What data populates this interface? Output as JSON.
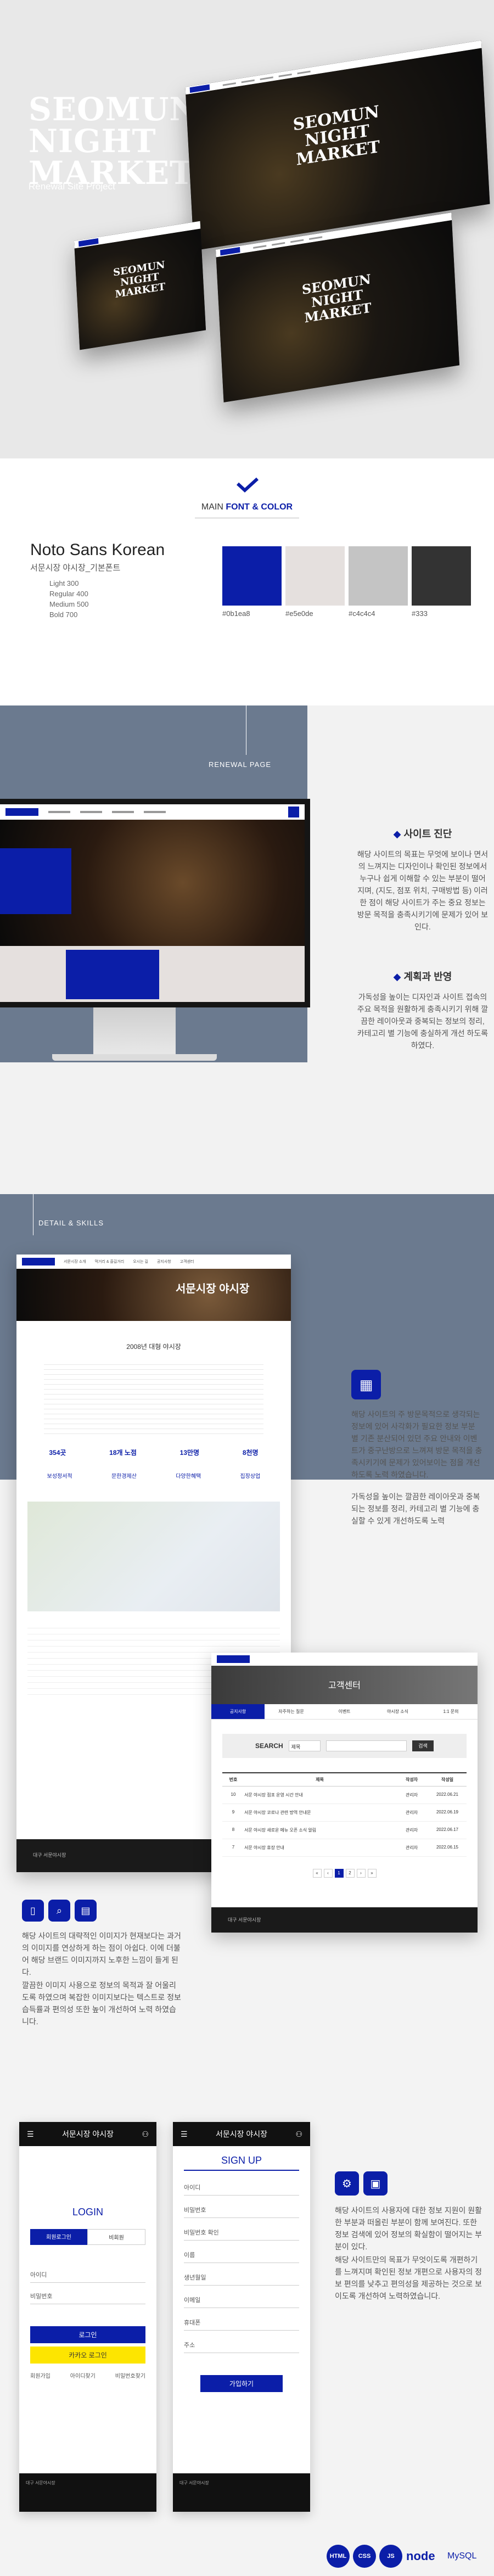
{
  "hero": {
    "title_lines": [
      "SEOMUN",
      "NIGHT",
      "MARKET"
    ],
    "subtitle": "Renewal Site Project",
    "mock_title_lines": [
      "SEOMUN",
      "NIGHT",
      "MARKET"
    ],
    "background_color": "#e8e8e8"
  },
  "font_color": {
    "heading_prefix": "MAIN",
    "heading_bold": "FONT & COLOR",
    "font_name": "Noto Sans Korean",
    "font_caption": "서문시장 야시장_기본폰트",
    "weights": [
      "Light 300",
      "Regular 400",
      "Medium 500",
      "Bold 700"
    ],
    "colors": [
      {
        "hex": "#0b1ea8",
        "label": "#0b1ea8"
      },
      {
        "hex": "#e5e0de",
        "label": "#e5e0de"
      },
      {
        "hex": "#c4c4c4",
        "label": "#c4c4c4"
      },
      {
        "hex": "#333333",
        "label": "#333"
      }
    ]
  },
  "renewal": {
    "label": "RENEWAL PAGE",
    "features": [
      {
        "title": "사이트 진단",
        "text": "해당 사이트의 목표는 무엇에 보이나 면서의 느껴지는 디자인이나 확인된 정보에서 누구나 쉽게 이해할 수 있는 부분이 떨어지며, (지도, 점포 위치, 구매방법 등) 이러한 점이 해당 사이트가 주는 중요 정보는 방문 목적을 충족시키기에 문제가 있어 보인다."
      },
      {
        "title": "계획과 반영",
        "text": "가독성을 높이는 디자인과 사이트 접속의 주요 목적을 원활하게 충족시키기 위해 깔끔한 레이아웃과 중복되는 정보의 정리, 카테고리 별 기능에 충실하게 개선 하도록 하였다."
      }
    ]
  },
  "detail": {
    "label": "DETAIL & SKILLS",
    "right_text_1": "해당 사이트의 주 방문목적으로 생각되는 정보에 있어 사각화가 필요한 정보 부분 별 기존 분산되어 있던 주요 안내와 이벤트가 중구난방으로 느껴져 방문 목적을 충족시키기에 문제가 있어보이는 점을 개선하도록 노력 하였습니다.",
    "right_text_2": "가독성을 높이는 깔끔한 레이아웃과 중복되는 정보를 정리, 카테고리 별 기능에 충실할 수 있게 개선하도록 노력",
    "left_text_1": "해당 사이트의 대략적인 이미지가 현재보다는 과거의 이미지를 연상하게 하는 점이 아쉽다. 이에 더불어 해당 브랜드 이미지까지 노후한 느낌이 들게 된다.",
    "left_text_2": "깔끔한 이미지 사용으로 정보의 목적과 잘 어울리도록 하였으며 복잡한 이미지보다는 텍스트로 정보 습득률과 편의성 또한 높이 개선하여 노력 하였습니다.",
    "page1": {
      "menu": [
        "서문시장 소개",
        "먹거리 & 즐길거리",
        "오시는 길",
        "공지사항",
        "고객센터"
      ],
      "banner": "서문시장 야시장",
      "intro_heading": "2008년 대형 야시장",
      "stats": [
        "354곳",
        "18개 노점",
        "13만명",
        "8천명"
      ],
      "cats": [
        "보성정서적",
        "문한경제산",
        "다양한혜택",
        "집장상업"
      ],
      "footer": "대구 서문야시장"
    },
    "page2": {
      "title": "고객센터",
      "tabs": [
        "공지사항",
        "자주하는 질문",
        "이벤트",
        "야시장 소식",
        "1:1 문의"
      ],
      "search_label": "SEARCH",
      "search_select": "제목",
      "search_button": "검색",
      "columns": [
        "번호",
        "제목",
        "작성자",
        "작성일"
      ],
      "rows": [
        {
          "no": "10",
          "title": "서문 야시장 점포 운영 시간 안내",
          "author": "관리자",
          "date": "2022.06.21"
        },
        {
          "no": "9",
          "title": "서문 야시장 코로나 관련 방역 안내문",
          "author": "관리자",
          "date": "2022.06.19"
        },
        {
          "no": "8",
          "title": "서문 야시장 새로운 메뉴 오픈 소식 알림",
          "author": "관리자",
          "date": "2022.06.17"
        },
        {
          "no": "7",
          "title": "서문 야시장 휴장 안내",
          "author": "관리자",
          "date": "2022.06.15"
        }
      ],
      "pages": [
        "«",
        "‹",
        "1",
        "2",
        "›",
        "»"
      ],
      "footer": "대구 서문야시장"
    }
  },
  "mobile": {
    "login": {
      "header": "서문시장 야시장",
      "title": "LOGIN",
      "tabs": [
        "회원로그인",
        "비회원"
      ],
      "id_placeholder": "아이디",
      "pw_placeholder": "비밀번호",
      "login_button": "로그인",
      "kakao_button": "카카오 로그인",
      "links": [
        "회원가입",
        "아이디찾기",
        "비밀번호찾기"
      ],
      "footer": "대구 서문야시장"
    },
    "signup": {
      "header": "서문시장 야시장",
      "title": "SIGN UP",
      "fields": [
        "아이디",
        "비밀번호",
        "비밀번호 확인",
        "이름",
        "생년월일",
        "이메일",
        "휴대폰",
        "주소"
      ],
      "button": "가입하기",
      "footer": "대구 서문야시장"
    },
    "text_1": "해당 사이트의 사용자에 대한 정보 지원이 원활한 부분과 떠올린 부분이 함께 보여진다. 또한 정보 검색에 있어 정보의 확실함이 떨어지는 부분이 있다.",
    "text_2": "해당 사이트만의 목표가 무엇이도록 개편하기를 느껴지며 확인된 정보 개편으로 사용자의 정보 편의를 낮추고 편의성을 제공하는 것으로 보이도록 개선하여 노력하였습니다.",
    "skills": [
      "HTML",
      "CSS",
      "JS",
      "node",
      "MySQL"
    ]
  }
}
